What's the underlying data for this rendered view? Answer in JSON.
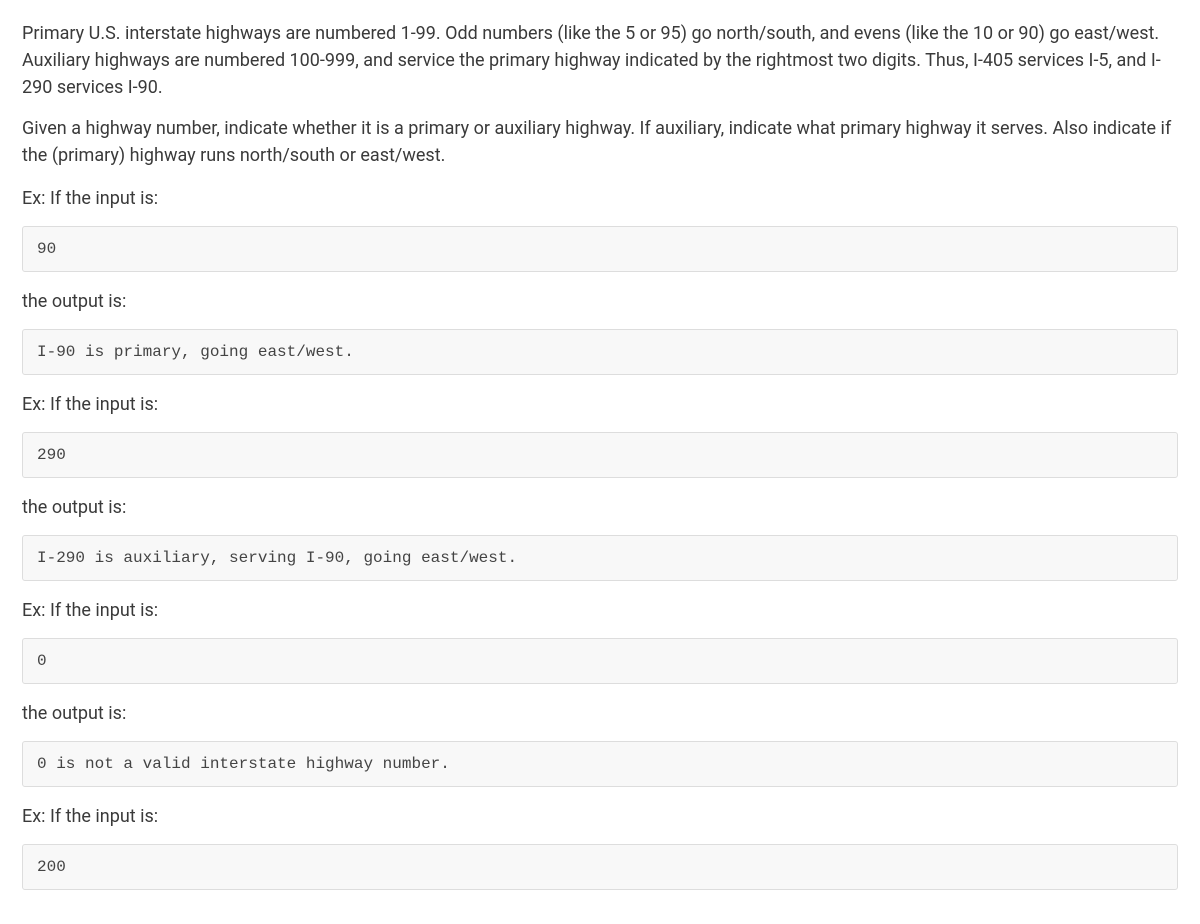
{
  "intro": {
    "p1": "Primary U.S. interstate highways are numbered 1-99. Odd numbers (like the 5 or 95) go north/south, and evens (like the 10 or 90) go east/west. Auxiliary highways are numbered 100-999, and service the primary highway indicated by the rightmost two digits. Thus, I-405 services I-5, and I-290 services I-90.",
    "p2": "Given a highway number, indicate whether it is a primary or auxiliary highway. If auxiliary, indicate what primary highway it serves. Also indicate if the (primary) highway runs north/south or east/west."
  },
  "labels": {
    "ex_input": "Ex: If the input is:",
    "output": "the output is:"
  },
  "examples": [
    {
      "input": "90",
      "output": "I-90 is primary, going east/west."
    },
    {
      "input": "290",
      "output": "I-290 is auxiliary, serving I-90, going east/west."
    },
    {
      "input": "0",
      "output": "0 is not a valid interstate highway number."
    },
    {
      "input": "200"
    }
  ]
}
